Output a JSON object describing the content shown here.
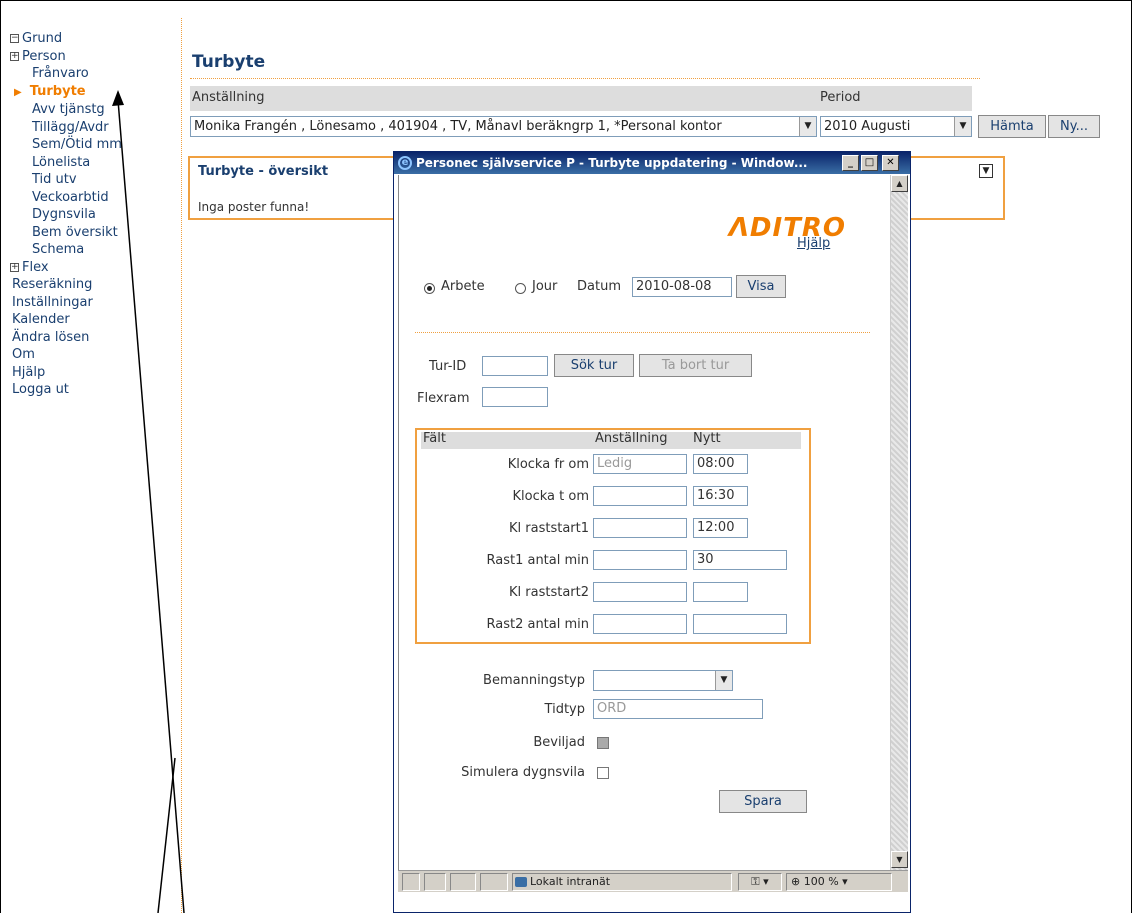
{
  "sidebar": {
    "items": [
      {
        "label": "Grund",
        "type": "group"
      },
      {
        "label": "Person",
        "type": "group-sub"
      },
      {
        "label": "Frånvaro"
      },
      {
        "label": "Turbyte",
        "active": true
      },
      {
        "label": "Avv tjänstg"
      },
      {
        "label": "Tillägg/Avdr"
      },
      {
        "label": "Sem/Ötid mm"
      },
      {
        "label": "Lönelista"
      },
      {
        "label": "Tid utv"
      },
      {
        "label": "Veckoarbtid"
      },
      {
        "label": "Dygnsvila"
      },
      {
        "label": "Bem översikt"
      },
      {
        "label": "Schema"
      },
      {
        "label": "Flex",
        "type": "group"
      },
      {
        "label": "Reseräkning"
      },
      {
        "label": "Inställningar"
      },
      {
        "label": "Kalender"
      },
      {
        "label": "Ändra lösen"
      },
      {
        "label": "Om"
      },
      {
        "label": "Hjälp"
      },
      {
        "label": "Logga ut"
      }
    ]
  },
  "page": {
    "title": "Turbyte",
    "col_anstallning": "Anställning",
    "col_period": "Period",
    "anstallning_value": "Monika Frangén , Lönesamo , 401904 , TV, Månavl beräkngrp 1, *Personal kontor",
    "period_value": "2010 Augusti",
    "hamta_label": "Hämta",
    "ny_label": "Ny...",
    "overview_title": "Turbyte - översikt",
    "overview_msg": "Inga poster funna!"
  },
  "popup": {
    "title": "Personec självservice P - Turbyte uppdatering - Window...",
    "logo": "ΛDITRO",
    "help_link": "Hjälp",
    "radio_arbete": "Arbete",
    "radio_jour": "Jour",
    "datum_label": "Datum",
    "datum_value": "2010-08-08",
    "visa_label": "Visa",
    "turid_label": "Tur-ID",
    "sok_tur_label": "Sök tur",
    "ta_bort_tur_label": "Ta bort tur",
    "flexram_label": "Flexram",
    "fields_header": {
      "falt": "Fält",
      "anstallning": "Anställning",
      "nytt": "Nytt"
    },
    "fields": [
      {
        "label": "Klocka fr om",
        "anst": "Ledig",
        "nytt": "08:00"
      },
      {
        "label": "Klocka t om",
        "anst": "",
        "nytt": "16:30"
      },
      {
        "label": "Kl raststart1",
        "anst": "",
        "nytt": "12:00"
      },
      {
        "label": "Rast1 antal min",
        "anst": "",
        "nytt": "30"
      },
      {
        "label": "Kl raststart2",
        "anst": "",
        "nytt": ""
      },
      {
        "label": "Rast2 antal min",
        "anst": "",
        "nytt": ""
      }
    ],
    "bemanningstyp_label": "Bemanningstyp",
    "tidtyp_label": "Tidtyp",
    "tidtyp_value": "ORD",
    "beviljad_label": "Beviljad",
    "simulera_label": "Simulera dygnsvila",
    "spara_label": "Spara",
    "status_zone": "Lokalt intranät",
    "status_zoom": "100 %"
  }
}
